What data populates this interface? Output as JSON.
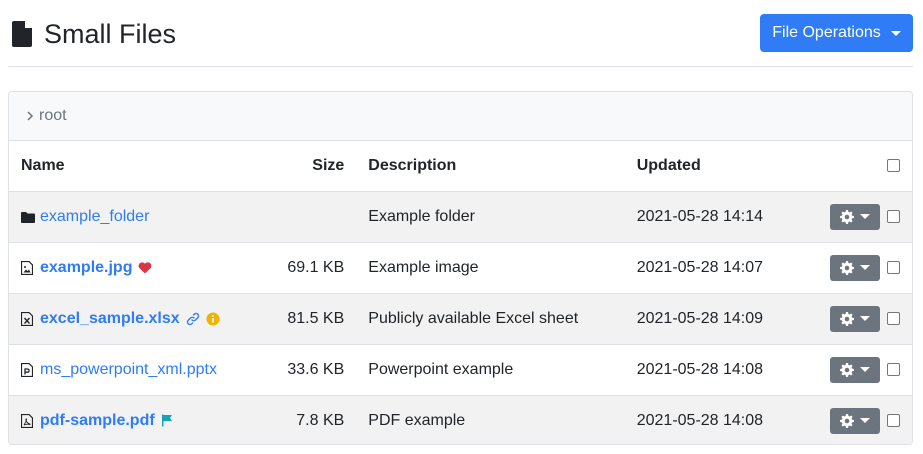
{
  "header": {
    "title": "Small Files",
    "title_icon": "file-icon",
    "file_operations_label": "File Operations"
  },
  "breadcrumb": {
    "chevron_icon": "chevron-right-icon",
    "label": "root"
  },
  "table": {
    "columns": {
      "name": "Name",
      "size": "Size",
      "description": "Description",
      "updated": "Updated"
    },
    "rows": [
      {
        "name": "example_folder",
        "icon": "folder-icon",
        "bold": false,
        "size": "",
        "description": "Example folder",
        "updated": "2021-05-28 14:14",
        "extra_icons": []
      },
      {
        "name": "example.jpg",
        "icon": "image-file-icon",
        "bold": true,
        "size": "69.1 KB",
        "description": "Example image",
        "updated": "2021-05-28 14:07",
        "extra_icons": [
          "heart-icon"
        ]
      },
      {
        "name": "excel_sample.xlsx",
        "icon": "excel-file-icon",
        "bold": true,
        "size": "81.5 KB",
        "description": "Publicly available Excel sheet",
        "updated": "2021-05-28 14:09",
        "extra_icons": [
          "link-icon",
          "info-icon"
        ]
      },
      {
        "name": "ms_powerpoint_xml.pptx",
        "icon": "powerpoint-file-icon",
        "bold": false,
        "size": "33.6 KB",
        "description": "Powerpoint example",
        "updated": "2021-05-28 14:08",
        "extra_icons": []
      },
      {
        "name": "pdf-sample.pdf",
        "icon": "pdf-file-icon",
        "bold": true,
        "size": "7.8 KB",
        "description": "PDF example",
        "updated": "2021-05-28 14:08",
        "extra_icons": [
          "flag-icon"
        ]
      }
    ]
  },
  "colors": {
    "primary": "#2f7cf6",
    "secondary": "#6c757d",
    "heart": "#dc3545",
    "info": "#f0b400",
    "flag": "#17a2b8"
  }
}
